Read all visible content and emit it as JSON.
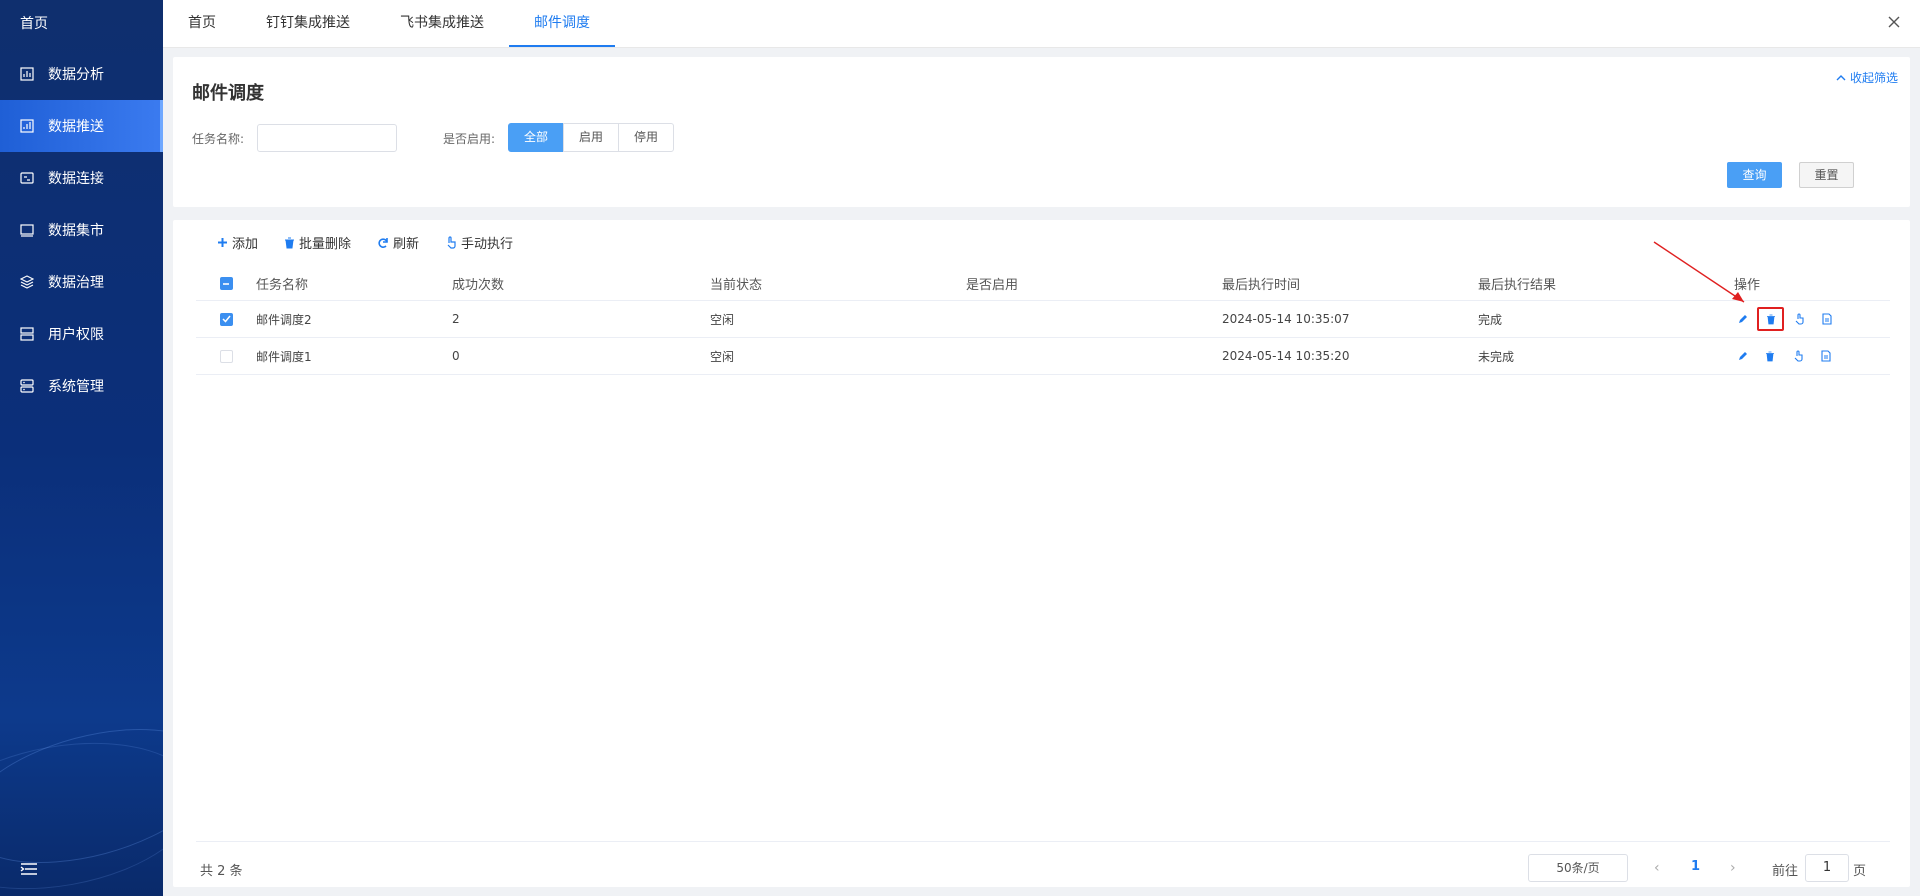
{
  "sidebar": {
    "home": "首页",
    "items": [
      {
        "label": "数据分析",
        "icon": "chart-icon"
      },
      {
        "label": "数据推送",
        "icon": "push-icon",
        "active": true
      },
      {
        "label": "数据连接",
        "icon": "connect-icon"
      },
      {
        "label": "数据集市",
        "icon": "market-icon"
      },
      {
        "label": "数据治理",
        "icon": "layers-icon"
      },
      {
        "label": "用户权限",
        "icon": "user-icon"
      },
      {
        "label": "系统管理",
        "icon": "settings-icon"
      }
    ]
  },
  "tabs": [
    {
      "label": "首页"
    },
    {
      "label": "钉钉集成推送"
    },
    {
      "label": "飞书集成推送"
    },
    {
      "label": "邮件调度",
      "active": true
    }
  ],
  "filter": {
    "title": "邮件调度",
    "collapse_label": "收起筛选",
    "task_name_label": "任务名称:",
    "task_name_value": "",
    "enabled_label": "是否启用:",
    "segments": [
      "全部",
      "启用",
      "停用"
    ],
    "query_label": "查询",
    "reset_label": "重置"
  },
  "toolbar": {
    "add": "添加",
    "batch_delete": "批量删除",
    "refresh": "刷新",
    "manual_run": "手动执行"
  },
  "table": {
    "headers": [
      "任务名称",
      "成功次数",
      "当前状态",
      "是否启用",
      "最后执行时间",
      "最后执行结果",
      "操作"
    ],
    "rows": [
      {
        "name": "邮件调度2",
        "success": "2",
        "status": "空闲",
        "enabled": false,
        "last_time": "2024-05-14 10:35:07",
        "last_result": "完成",
        "checked": true
      },
      {
        "name": "邮件调度1",
        "success": "0",
        "status": "空闲",
        "enabled": false,
        "last_time": "2024-05-14 10:35:20",
        "last_result": "未完成",
        "checked": false
      }
    ]
  },
  "pager": {
    "total": "共 2 条",
    "page_size": "50条/页",
    "current": "1",
    "goto_label": "前往",
    "goto_value": "1",
    "page_unit": "页"
  },
  "colors": {
    "primary": "#1f7cf0",
    "button_primary": "#4a9ff5",
    "highlight": "#e02020"
  }
}
